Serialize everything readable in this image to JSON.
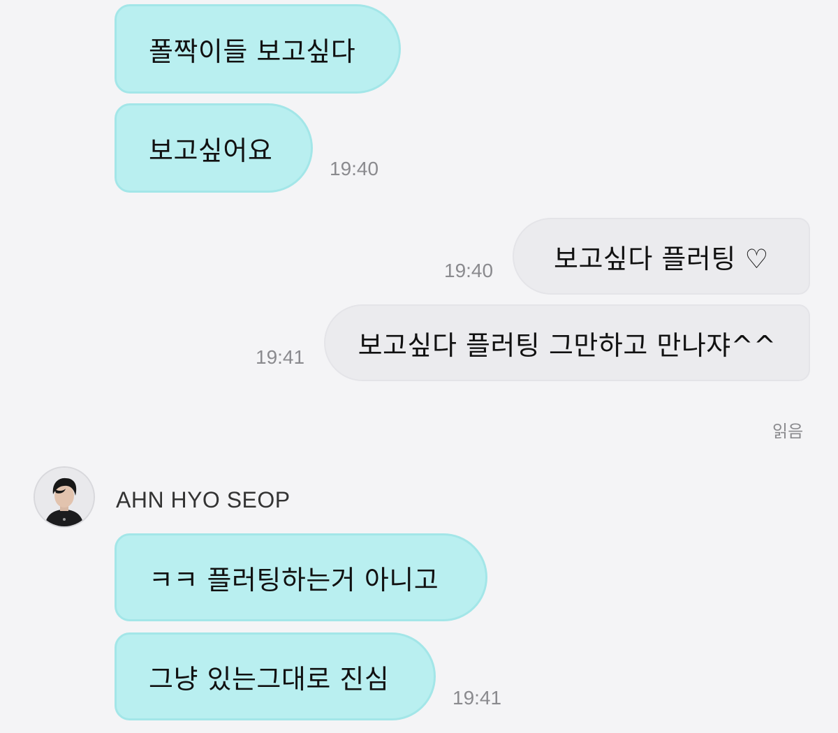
{
  "chat": {
    "messages": [
      {
        "text": "폴짝이들 보고싶다"
      },
      {
        "text": "보고싶어요",
        "time": "19:40"
      },
      {
        "text": "보고싶다 플러팅 ♡",
        "time": "19:40"
      },
      {
        "text": "보고싶다 플러팅 그만하고 만나쟈^^",
        "time": "19:41",
        "read_status": "읽음"
      },
      {
        "text": "ㅋㅋ 플러팅하는거 아니고"
      },
      {
        "text": "그냥 있는그대로 진심",
        "time": "19:41"
      }
    ],
    "sender": {
      "name": "AHN HYO SEOP",
      "avatar_icon": "profile-photo"
    }
  },
  "colors": {
    "background": "#f4f4f6",
    "friend_bubble": "#b9eff0",
    "my_bubble": "#ebebee",
    "timestamp": "#8a8a8e"
  }
}
